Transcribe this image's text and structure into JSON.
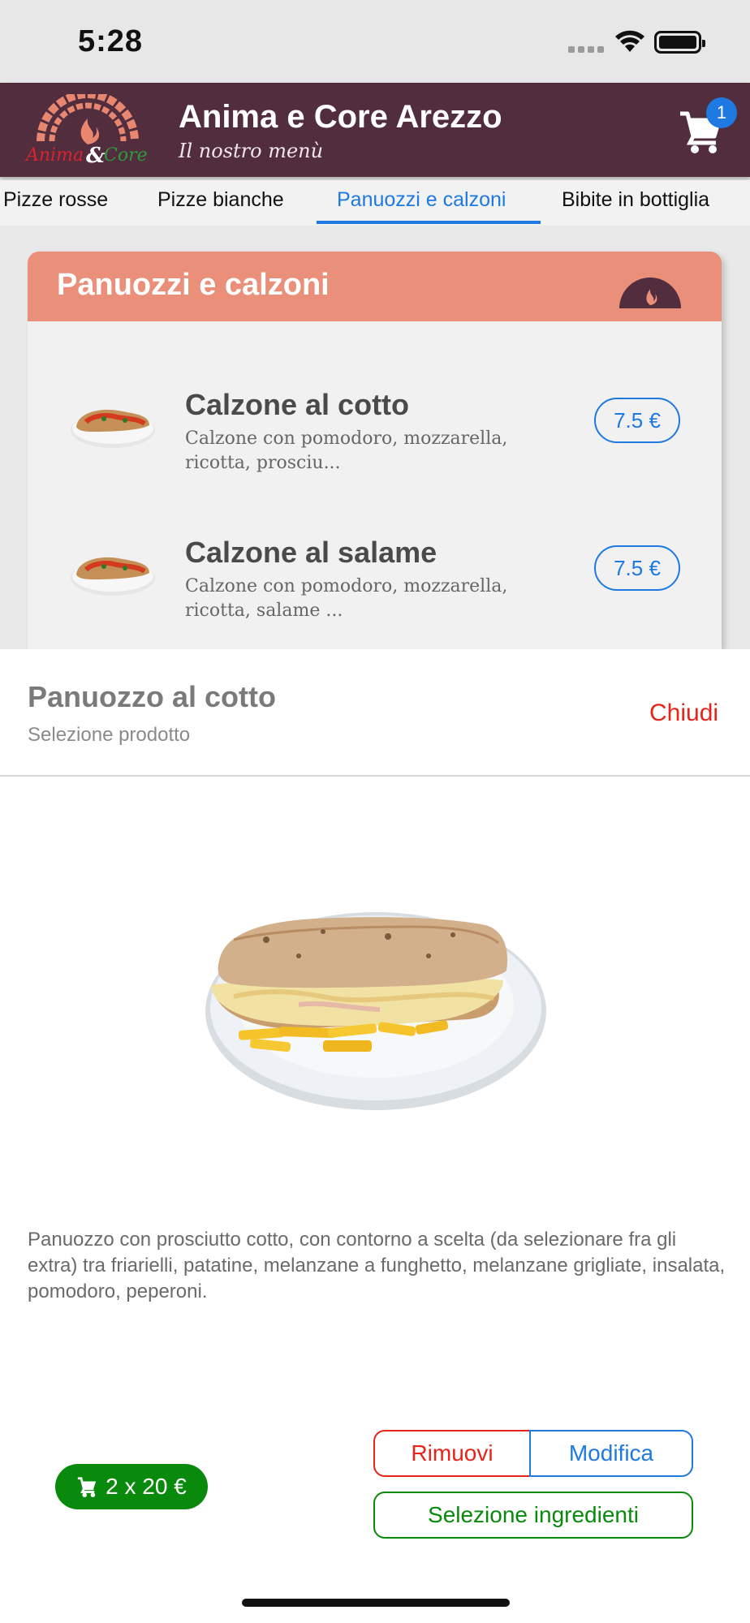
{
  "status_bar": {
    "time": "5:28"
  },
  "header": {
    "logo_text": "Anima & Core",
    "title": "Anima e Core Arezzo",
    "subtitle": "Il nostro menù",
    "cart_count": "1"
  },
  "tabs": [
    {
      "label": "Pizze rosse"
    },
    {
      "label": "Pizze bianche"
    },
    {
      "label": "Panuozzi e calzoni"
    },
    {
      "label": "Bibite in bottiglia"
    }
  ],
  "category": {
    "title": "Panuozzi e calzoni",
    "items": [
      {
        "name": "Calzone al cotto",
        "description": "Calzone con pomodoro, mozzarella, ricotta, prosciu...",
        "price": "7.5 €"
      },
      {
        "name": "Calzone al salame",
        "description": "Calzone con pomodoro, mozzarella, ricotta, salame ...",
        "price": "7.5 €"
      }
    ]
  },
  "sheet": {
    "title": "Panuozzo al cotto",
    "subtitle": "Selezione prodotto",
    "close_label": "Chiudi",
    "description": "Panuozzo con prosciutto cotto, con contorno a scelta (da selezionare fra gli extra) tra friarielli, patatine, melanzane a funghetto, melanzane grigliate, insalata, pomodoro, peperoni.",
    "quantity_label": "2 x 20 €",
    "remove_label": "Rimuovi",
    "edit_label": "Modifica",
    "ingredients_label": "Selezione ingredienti"
  },
  "colors": {
    "header_bg": "#512d3e",
    "category_header_bg": "#ea8f7a",
    "accent_blue": "#1e79e0",
    "remove_red": "#e5241a",
    "confirm_green": "#0a8a0c"
  }
}
